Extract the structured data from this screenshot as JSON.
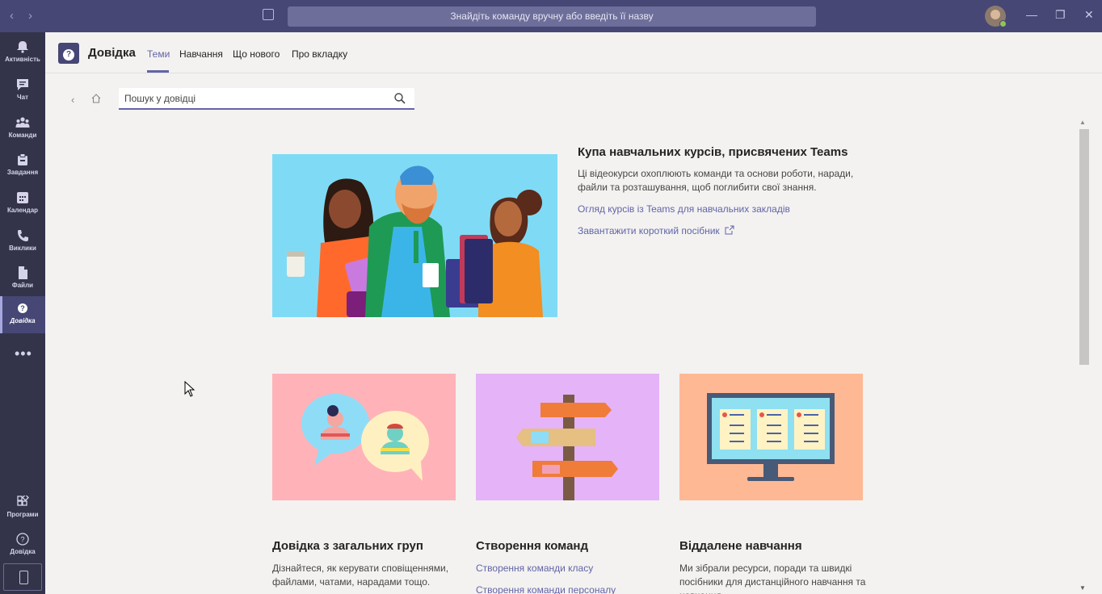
{
  "titlebar": {
    "back": "‹",
    "forward": "›",
    "search_placeholder": "Знайдіть команду вручну або введіть її назву",
    "minimize": "—",
    "restore": "❐",
    "close": "✕"
  },
  "appbar": {
    "items": [
      {
        "label": "Активність",
        "icon": "bell-icon"
      },
      {
        "label": "Чат",
        "icon": "chat-icon"
      },
      {
        "label": "Команди",
        "icon": "teams-icon"
      },
      {
        "label": "Завдання",
        "icon": "assignments-icon"
      },
      {
        "label": "Календар",
        "icon": "calendar-icon"
      },
      {
        "label": "Виклики",
        "icon": "phone-icon"
      },
      {
        "label": "Файли",
        "icon": "file-icon"
      },
      {
        "label": "Довідка",
        "icon": "help-icon"
      }
    ],
    "more": "•••",
    "apps_label": "Програми",
    "help_label": "Довідка"
  },
  "header": {
    "title": "Довідка",
    "tabs": [
      "Теми",
      "Навчання",
      "Що нового",
      "Про вкладку"
    ]
  },
  "search": {
    "placeholder": "Пошук у довідці"
  },
  "hero": {
    "title": "Купа навчальних курсів, присвячених Teams",
    "description": "Ці відеокурси охоплюють команди та основи роботи, наради, файли та розташування, щоб поглибити свої знання.",
    "link1": "Огляд курсів із Teams для навчальних закладів",
    "link2": "Завантажити короткий посібник"
  },
  "cards": [
    {
      "title": "Довідка з загальних груп",
      "description": "Дізнайтеся, як керувати сповіщеннями, файлами, чатами, нарадами тощо."
    },
    {
      "title": "Створення команд",
      "links": [
        "Створення команди класу",
        "Створення команди персоналу"
      ]
    },
    {
      "title": "Віддалене навчання",
      "description": "Ми зібрали ресурси, поради та швидкі посібники для дистанційного навчання та навчання"
    }
  ],
  "colors": {
    "accent": "#6264a7",
    "titlebar": "#464775",
    "appbar": "#33344a",
    "card1_bg": "#ffb3b8",
    "card2_bg": "#e5b3f7",
    "card3_bg": "#ffb894",
    "hero_bg": "#7fdbf5"
  }
}
